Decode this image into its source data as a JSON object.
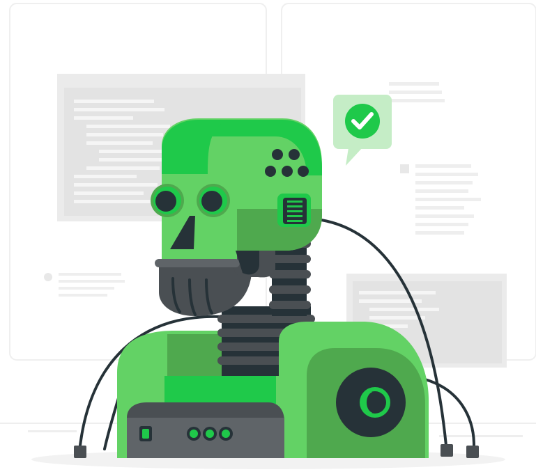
{
  "illustration": {
    "subject": "robot-illustration",
    "colors": {
      "primary_green": "#63D265",
      "bright_green": "#1FC94A",
      "mid_green": "#4FA94E",
      "dark_green": "#2F8C3C",
      "dark_body": "#263238",
      "gray_body": "#4A4F53",
      "panel_gray": "#5F6468",
      "light_gray": "#E5E5E5",
      "line_gray": "#F0F0F0",
      "white": "#FFFFFF"
    },
    "icons": [
      "check-icon",
      "speech-bubble-icon"
    ]
  }
}
